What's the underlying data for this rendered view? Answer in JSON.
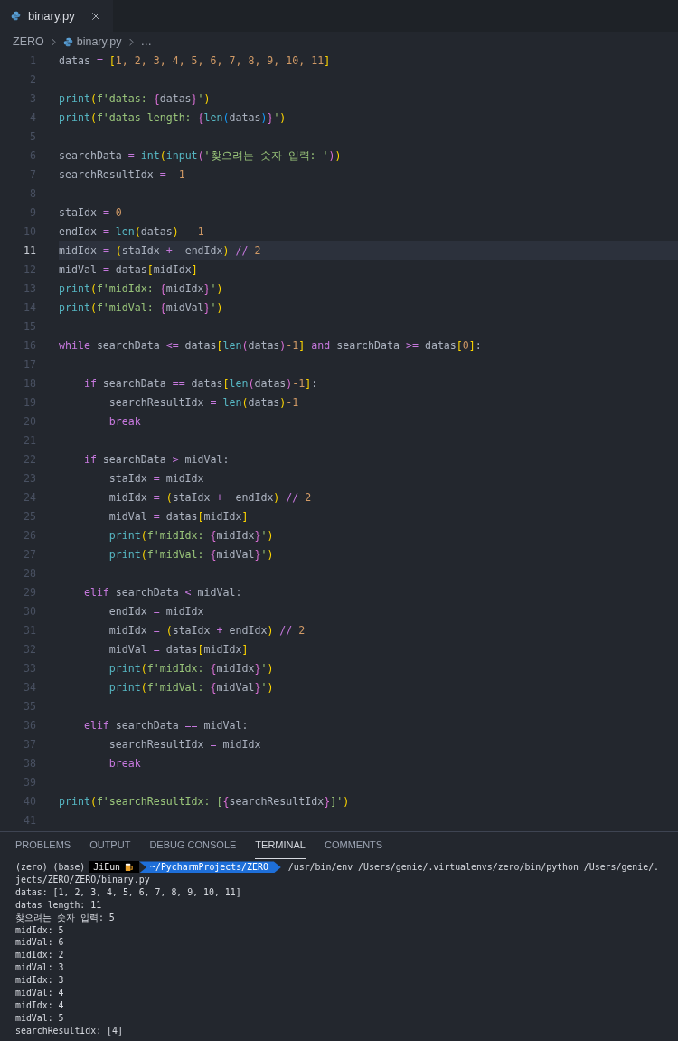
{
  "editor_tabs": [
    {
      "label": "binary.py",
      "selected": true
    }
  ],
  "breadcrumb": [
    {
      "kind": "folder",
      "label": "ZERO"
    },
    {
      "kind": "file",
      "label": "binary.py"
    },
    {
      "kind": "more",
      "label": "…"
    }
  ],
  "editor": {
    "lines": [
      {
        "number": "1",
        "active": false,
        "tokens": [
          {
            "kind": "plain",
            "text": "datas "
          },
          {
            "kind": "op",
            "text": "= "
          },
          {
            "kind": "b1",
            "text": "["
          },
          {
            "kind": "num",
            "text": "1, 2, 3, 4, 5, 6, 7, 8, 9, 10, 11"
          },
          {
            "kind": "b1",
            "text": "]"
          }
        ]
      },
      {
        "number": "2",
        "active": false
      },
      {
        "number": "3",
        "active": false,
        "tokens": [
          {
            "kind": "fn",
            "text": "print"
          },
          {
            "kind": "b1",
            "text": "("
          },
          {
            "kind": "str",
            "text": "f'datas: "
          },
          {
            "kind": "b2",
            "text": "{"
          },
          {
            "kind": "plain",
            "text": "datas"
          },
          {
            "kind": "b2",
            "text": "}"
          },
          {
            "kind": "str",
            "text": "'"
          },
          {
            "kind": "b1",
            "text": ")"
          }
        ]
      },
      {
        "number": "4",
        "active": false,
        "tokens": [
          {
            "kind": "fn",
            "text": "print"
          },
          {
            "kind": "b1",
            "text": "("
          },
          {
            "kind": "str",
            "text": "f'datas length: "
          },
          {
            "kind": "b2",
            "text": "{"
          },
          {
            "kind": "fn",
            "text": "len"
          },
          {
            "kind": "b3",
            "text": "("
          },
          {
            "kind": "plain",
            "text": "datas"
          },
          {
            "kind": "b3",
            "text": ")"
          },
          {
            "kind": "b2",
            "text": "}"
          },
          {
            "kind": "str",
            "text": "'"
          },
          {
            "kind": "b1",
            "text": ")"
          }
        ]
      },
      {
        "number": "5",
        "active": false
      },
      {
        "number": "6",
        "active": false,
        "tokens": [
          {
            "kind": "plain",
            "text": "searchData "
          },
          {
            "kind": "op",
            "text": "= "
          },
          {
            "kind": "fn",
            "text": "int"
          },
          {
            "kind": "b1",
            "text": "("
          },
          {
            "kind": "fn",
            "text": "input"
          },
          {
            "kind": "b2",
            "text": "("
          },
          {
            "kind": "str",
            "text": "'찾으려는 숫자 입력: '"
          },
          {
            "kind": "b2",
            "text": ")"
          },
          {
            "kind": "b1",
            "text": ")"
          }
        ]
      },
      {
        "number": "7",
        "active": false,
        "tokens": [
          {
            "kind": "plain",
            "text": "searchResultIdx "
          },
          {
            "kind": "op",
            "text": "= "
          },
          {
            "kind": "num",
            "text": "-1"
          }
        ]
      },
      {
        "number": "8",
        "active": false
      },
      {
        "number": "9",
        "active": false,
        "tokens": [
          {
            "kind": "plain",
            "text": "staIdx "
          },
          {
            "kind": "op",
            "text": "= "
          },
          {
            "kind": "num",
            "text": "0"
          }
        ]
      },
      {
        "number": "10",
        "active": false,
        "tokens": [
          {
            "kind": "plain",
            "text": "endIdx "
          },
          {
            "kind": "op",
            "text": "= "
          },
          {
            "kind": "fn",
            "text": "len"
          },
          {
            "kind": "b1",
            "text": "("
          },
          {
            "kind": "plain",
            "text": "datas"
          },
          {
            "kind": "b1",
            "text": ")"
          },
          {
            "kind": "op",
            "text": " - "
          },
          {
            "kind": "num",
            "text": "1"
          }
        ]
      },
      {
        "number": "11",
        "active": true,
        "tokens": [
          {
            "kind": "plain",
            "text": "midIdx "
          },
          {
            "kind": "op",
            "text": "= "
          },
          {
            "kind": "b1",
            "text": "("
          },
          {
            "kind": "plain",
            "text": "staIdx "
          },
          {
            "kind": "op",
            "text": "+"
          },
          {
            "kind": "plain",
            "text": "  endIdx"
          },
          {
            "kind": "b1",
            "text": ")"
          },
          {
            "kind": "op",
            "text": " // "
          },
          {
            "kind": "num",
            "text": "2"
          }
        ]
      },
      {
        "number": "12",
        "active": false,
        "tokens": [
          {
            "kind": "plain",
            "text": "midVal "
          },
          {
            "kind": "op",
            "text": "="
          },
          {
            "kind": "plain",
            "text": " datas"
          },
          {
            "kind": "b1",
            "text": "["
          },
          {
            "kind": "plain",
            "text": "midIdx"
          },
          {
            "kind": "b1",
            "text": "]"
          }
        ]
      },
      {
        "number": "13",
        "active": false,
        "tokens": [
          {
            "kind": "fn",
            "text": "print"
          },
          {
            "kind": "b1",
            "text": "("
          },
          {
            "kind": "str",
            "text": "f'midIdx: "
          },
          {
            "kind": "b2",
            "text": "{"
          },
          {
            "kind": "plain",
            "text": "midIdx"
          },
          {
            "kind": "b2",
            "text": "}"
          },
          {
            "kind": "str",
            "text": "'"
          },
          {
            "kind": "b1",
            "text": ")"
          }
        ]
      },
      {
        "number": "14",
        "active": false,
        "tokens": [
          {
            "kind": "fn",
            "text": "print"
          },
          {
            "kind": "b1",
            "text": "("
          },
          {
            "kind": "str",
            "text": "f'midVal: "
          },
          {
            "kind": "b2",
            "text": "{"
          },
          {
            "kind": "plain",
            "text": "midVal"
          },
          {
            "kind": "b2",
            "text": "}"
          },
          {
            "kind": "str",
            "text": "'"
          },
          {
            "kind": "b1",
            "text": ")"
          }
        ]
      },
      {
        "number": "15",
        "active": false
      },
      {
        "number": "16",
        "active": false,
        "tokens": [
          {
            "kind": "kw",
            "text": "while"
          },
          {
            "kind": "plain",
            "text": " searchData "
          },
          {
            "kind": "op",
            "text": "<="
          },
          {
            "kind": "plain",
            "text": " datas"
          },
          {
            "kind": "b1",
            "text": "["
          },
          {
            "kind": "fn",
            "text": "len"
          },
          {
            "kind": "b2",
            "text": "("
          },
          {
            "kind": "plain",
            "text": "datas"
          },
          {
            "kind": "b2",
            "text": ")"
          },
          {
            "kind": "num",
            "text": "-1"
          },
          {
            "kind": "b1",
            "text": "]"
          },
          {
            "kind": "kw",
            "text": " and"
          },
          {
            "kind": "plain",
            "text": " searchData "
          },
          {
            "kind": "op",
            "text": ">="
          },
          {
            "kind": "plain",
            "text": " datas"
          },
          {
            "kind": "b1",
            "text": "["
          },
          {
            "kind": "num",
            "text": "0"
          },
          {
            "kind": "b1",
            "text": "]"
          },
          {
            "kind": "plain",
            "text": ":"
          }
        ]
      },
      {
        "number": "17",
        "active": false
      },
      {
        "number": "18",
        "active": false,
        "tokens": [
          {
            "kind": "kw",
            "text": "    if"
          },
          {
            "kind": "plain",
            "text": " searchData "
          },
          {
            "kind": "op",
            "text": "=="
          },
          {
            "kind": "plain",
            "text": " datas"
          },
          {
            "kind": "b1",
            "text": "["
          },
          {
            "kind": "fn",
            "text": "len"
          },
          {
            "kind": "b2",
            "text": "("
          },
          {
            "kind": "plain",
            "text": "datas"
          },
          {
            "kind": "b2",
            "text": ")"
          },
          {
            "kind": "num",
            "text": "-1"
          },
          {
            "kind": "b1",
            "text": "]"
          },
          {
            "kind": "plain",
            "text": ":"
          }
        ]
      },
      {
        "number": "19",
        "active": false,
        "tokens": [
          {
            "kind": "plain",
            "text": "        searchResultIdx "
          },
          {
            "kind": "op",
            "text": "= "
          },
          {
            "kind": "fn",
            "text": "len"
          },
          {
            "kind": "b1",
            "text": "("
          },
          {
            "kind": "plain",
            "text": "datas"
          },
          {
            "kind": "b1",
            "text": ")"
          },
          {
            "kind": "num",
            "text": "-1"
          }
        ]
      },
      {
        "number": "20",
        "active": false,
        "tokens": [
          {
            "kind": "kw",
            "text": "        break"
          }
        ]
      },
      {
        "number": "21",
        "active": false
      },
      {
        "number": "22",
        "active": false,
        "tokens": [
          {
            "kind": "kw",
            "text": "    if"
          },
          {
            "kind": "plain",
            "text": " searchData "
          },
          {
            "kind": "op",
            "text": ">"
          },
          {
            "kind": "plain",
            "text": " midVal:"
          }
        ]
      },
      {
        "number": "23",
        "active": false,
        "tokens": [
          {
            "kind": "plain",
            "text": "        staIdx "
          },
          {
            "kind": "op",
            "text": "="
          },
          {
            "kind": "plain",
            "text": " midIdx"
          }
        ]
      },
      {
        "number": "24",
        "active": false,
        "tokens": [
          {
            "kind": "plain",
            "text": "        midIdx "
          },
          {
            "kind": "op",
            "text": "= "
          },
          {
            "kind": "b1",
            "text": "("
          },
          {
            "kind": "plain",
            "text": "staIdx "
          },
          {
            "kind": "op",
            "text": "+"
          },
          {
            "kind": "plain",
            "text": "  endIdx"
          },
          {
            "kind": "b1",
            "text": ")"
          },
          {
            "kind": "op",
            "text": " // "
          },
          {
            "kind": "num",
            "text": "2"
          }
        ]
      },
      {
        "number": "25",
        "active": false,
        "tokens": [
          {
            "kind": "plain",
            "text": "        midVal "
          },
          {
            "kind": "op",
            "text": "="
          },
          {
            "kind": "plain",
            "text": " datas"
          },
          {
            "kind": "b1",
            "text": "["
          },
          {
            "kind": "plain",
            "text": "midIdx"
          },
          {
            "kind": "b1",
            "text": "]"
          }
        ]
      },
      {
        "number": "26",
        "active": false,
        "tokens": [
          {
            "kind": "fn",
            "text": "        print"
          },
          {
            "kind": "b1",
            "text": "("
          },
          {
            "kind": "str",
            "text": "f'midIdx: "
          },
          {
            "kind": "b2",
            "text": "{"
          },
          {
            "kind": "plain",
            "text": "midIdx"
          },
          {
            "kind": "b2",
            "text": "}"
          },
          {
            "kind": "str",
            "text": "'"
          },
          {
            "kind": "b1",
            "text": ")"
          }
        ]
      },
      {
        "number": "27",
        "active": false,
        "tokens": [
          {
            "kind": "fn",
            "text": "        print"
          },
          {
            "kind": "b1",
            "text": "("
          },
          {
            "kind": "str",
            "text": "f'midVal: "
          },
          {
            "kind": "b2",
            "text": "{"
          },
          {
            "kind": "plain",
            "text": "midVal"
          },
          {
            "kind": "b2",
            "text": "}"
          },
          {
            "kind": "str",
            "text": "'"
          },
          {
            "kind": "b1",
            "text": ")"
          }
        ]
      },
      {
        "number": "28",
        "active": false
      },
      {
        "number": "29",
        "active": false,
        "tokens": [
          {
            "kind": "kw",
            "text": "    elif"
          },
          {
            "kind": "plain",
            "text": " searchData "
          },
          {
            "kind": "op",
            "text": "<"
          },
          {
            "kind": "plain",
            "text": " midVal:"
          }
        ]
      },
      {
        "number": "30",
        "active": false,
        "tokens": [
          {
            "kind": "plain",
            "text": "        endIdx "
          },
          {
            "kind": "op",
            "text": "="
          },
          {
            "kind": "plain",
            "text": " midIdx"
          }
        ]
      },
      {
        "number": "31",
        "active": false,
        "tokens": [
          {
            "kind": "plain",
            "text": "        midIdx "
          },
          {
            "kind": "op",
            "text": "= "
          },
          {
            "kind": "b1",
            "text": "("
          },
          {
            "kind": "plain",
            "text": "staIdx "
          },
          {
            "kind": "op",
            "text": "+"
          },
          {
            "kind": "plain",
            "text": " endIdx"
          },
          {
            "kind": "b1",
            "text": ")"
          },
          {
            "kind": "op",
            "text": " // "
          },
          {
            "kind": "num",
            "text": "2"
          }
        ]
      },
      {
        "number": "32",
        "active": false,
        "tokens": [
          {
            "kind": "plain",
            "text": "        midVal "
          },
          {
            "kind": "op",
            "text": "="
          },
          {
            "kind": "plain",
            "text": " datas"
          },
          {
            "kind": "b1",
            "text": "["
          },
          {
            "kind": "plain",
            "text": "midIdx"
          },
          {
            "kind": "b1",
            "text": "]"
          }
        ]
      },
      {
        "number": "33",
        "active": false,
        "tokens": [
          {
            "kind": "fn",
            "text": "        print"
          },
          {
            "kind": "b1",
            "text": "("
          },
          {
            "kind": "str",
            "text": "f'midIdx: "
          },
          {
            "kind": "b2",
            "text": "{"
          },
          {
            "kind": "plain",
            "text": "midIdx"
          },
          {
            "kind": "b2",
            "text": "}"
          },
          {
            "kind": "str",
            "text": "'"
          },
          {
            "kind": "b1",
            "text": ")"
          }
        ]
      },
      {
        "number": "34",
        "active": false,
        "tokens": [
          {
            "kind": "fn",
            "text": "        print"
          },
          {
            "kind": "b1",
            "text": "("
          },
          {
            "kind": "str",
            "text": "f'midVal: "
          },
          {
            "kind": "b2",
            "text": "{"
          },
          {
            "kind": "plain",
            "text": "midVal"
          },
          {
            "kind": "b2",
            "text": "}"
          },
          {
            "kind": "str",
            "text": "'"
          },
          {
            "kind": "b1",
            "text": ")"
          }
        ]
      },
      {
        "number": "35",
        "active": false
      },
      {
        "number": "36",
        "active": false,
        "tokens": [
          {
            "kind": "kw",
            "text": "    elif"
          },
          {
            "kind": "plain",
            "text": " searchData "
          },
          {
            "kind": "op",
            "text": "=="
          },
          {
            "kind": "plain",
            "text": " midVal:"
          }
        ]
      },
      {
        "number": "37",
        "active": false,
        "tokens": [
          {
            "kind": "plain",
            "text": "        searchResultIdx "
          },
          {
            "kind": "op",
            "text": "="
          },
          {
            "kind": "plain",
            "text": " midIdx"
          }
        ]
      },
      {
        "number": "38",
        "active": false,
        "tokens": [
          {
            "kind": "kw",
            "text": "        break"
          }
        ]
      },
      {
        "number": "39",
        "active": false
      },
      {
        "number": "40",
        "active": false,
        "tokens": [
          {
            "kind": "fn",
            "text": "print"
          },
          {
            "kind": "b1",
            "text": "("
          },
          {
            "kind": "str",
            "text": "f'searchResultIdx: ["
          },
          {
            "kind": "b2",
            "text": "{"
          },
          {
            "kind": "plain",
            "text": "searchResultIdx"
          },
          {
            "kind": "b2",
            "text": "}"
          },
          {
            "kind": "str",
            "text": "]'"
          },
          {
            "kind": "b1",
            "text": ")"
          }
        ]
      },
      {
        "number": "41",
        "active": false
      }
    ]
  },
  "panel_tabs": [
    {
      "label": "PROBLEMS",
      "selected": false
    },
    {
      "label": "OUTPUT",
      "selected": false
    },
    {
      "label": "DEBUG CONSOLE",
      "selected": false
    },
    {
      "label": "TERMINAL",
      "selected": true
    },
    {
      "label": "COMMENTS",
      "selected": false
    }
  ],
  "terminal": {
    "prompt": {
      "env": "(zero) (base)",
      "user": "JiEun",
      "path": "~/PycharmProjects/ZERO",
      "command": "/usr/bin/env /Users/genie/.virtualenvs/zero/bin/python /Users/genie/."
    },
    "output": [
      "jects/ZERO/ZERO/binary.py",
      "datas: [1, 2, 3, 4, 5, 6, 7, 8, 9, 10, 11]",
      "datas length: 11",
      "찾으려는 숫자 입력: 5",
      "midIdx: 5",
      "midVal: 6",
      "midIdx: 2",
      "midVal: 3",
      "midIdx: 3",
      "midVal: 4",
      "midIdx: 4",
      "midVal: 5",
      "searchResultIdx: [4]"
    ]
  }
}
